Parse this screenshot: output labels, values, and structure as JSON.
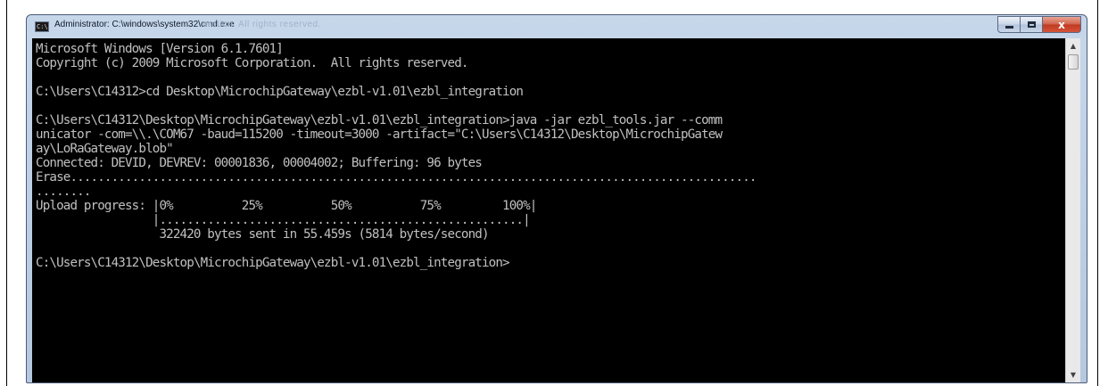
{
  "window": {
    "title": "Administrator: C:\\windows\\system32\\cmd.exe",
    "title_overlay": "oration.  All rights reserved.",
    "icon": "cmd-icon",
    "icon_label": "C:\\"
  },
  "caption_buttons": {
    "minimize": "minimize-icon",
    "maximize": "maximize-icon",
    "close_label": "x"
  },
  "console": {
    "lines": [
      "Microsoft Windows [Version 6.1.7601]",
      "Copyright (c) 2009 Microsoft Corporation.  All rights reserved.",
      "",
      "C:\\Users\\C14312>cd Desktop\\MicrochipGateway\\ezbl-v1.01\\ezbl_integration",
      "",
      "C:\\Users\\C14312\\Desktop\\MicrochipGateway\\ezbl-v1.01\\ezbl_integration>java -jar ezbl_tools.jar --comm",
      "unicator -com=\\\\.\\COM67 -baud=115200 -timeout=3000 -artifact=\"C:\\Users\\C14312\\Desktop\\MicrochipGatew",
      "ay\\LoRaGateway.blob\"",
      "Connected: DEVID, DEVREV: 00001836, 00004002; Buffering: 96 bytes",
      "Erase....................................................................................................",
      "........",
      "Upload progress: |0%          25%          50%          75%         100%|",
      "                 |.....................................................|",
      "                  322420 bytes sent in 55.459s (5814 bytes/second)",
      "",
      "C:\\Users\\C14312\\Desktop\\MicrochipGateway\\ezbl-v1.01\\ezbl_integration>"
    ]
  },
  "scrollbar": {
    "up": "scroll-up-arrow-icon",
    "down": "scroll-down-arrow-icon"
  }
}
